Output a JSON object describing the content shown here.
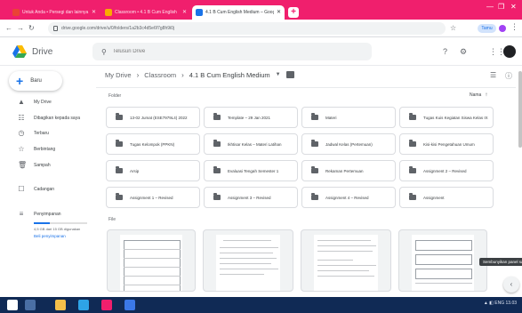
{
  "browser": {
    "tabs": [
      {
        "title": "Untuk Anda • Persegi dan lainnya",
        "favicon_color": "#ea4335",
        "active": false
      },
      {
        "title": "Classroom • 4.1 B Cum English",
        "favicon_color": "#f9ab00",
        "active": false
      },
      {
        "title": "4.1 B Cum English Medium – Google Drive",
        "favicon_color": "#1a73e8",
        "active": true
      }
    ],
    "new_tab": "+",
    "url": "drive.google.com/drive/u/0/folders/1a2b3c4d5e6f7g8h9i0j",
    "profile_label": "Tamu",
    "window_controls": [
      "—",
      "❐",
      "✕"
    ]
  },
  "drive": {
    "brand": "Drive",
    "search_placeholder": "Telusuri Drive",
    "header_icons": [
      "help-icon",
      "settings-icon",
      "apps-icon"
    ],
    "new_button": "Baru",
    "sidebar": [
      {
        "icon": "drive-icon",
        "glyph": "▲",
        "label": "My Drive"
      },
      {
        "icon": "shared-icon",
        "glyph": "☷",
        "label": "Dibagikan kepada saya"
      },
      {
        "icon": "recent-icon",
        "glyph": "◷",
        "label": "Terbaru"
      },
      {
        "icon": "star-icon",
        "glyph": "☆",
        "label": "Berbintang"
      },
      {
        "icon": "trash-icon",
        "glyph": "🗑",
        "label": "Sampah"
      },
      {
        "icon": "backup-icon",
        "glyph": "☐",
        "label": "Cadangan"
      },
      {
        "icon": "storage-icon",
        "glyph": "≡",
        "label": "Penyimpanan"
      }
    ],
    "storage": {
      "used_fraction": 0.3,
      "text": "4,5 GB dari 15 GB digunakan",
      "buy_label": "Beli penyimpanan"
    },
    "breadcrumb": [
      "My Drive",
      "Classroom",
      "4.1 B Cum English Medium"
    ],
    "view_icons": [
      "list-view-icon",
      "info-icon"
    ],
    "folders_label": "Folder",
    "sort_label": "Nama",
    "sort_arrow": "↑",
    "folders": [
      "13-02 Jumat (ESE7979L4) 2022",
      "Template – 29 Jan 2021",
      "Materi",
      "Tugas Kuis Kegiatan Siswa Kelas IX",
      "Tugas Kelompok (PPKN)",
      "Ikhtisar Kelas – Materi Latihan",
      "Jadwal Kelas (Pertemuan)",
      "Kisi-kisi Pengetahuan Umum",
      "Arsip",
      "Evaluasi Tengah Semester 1",
      "Rekaman Pertemuan",
      "Assignment 2 – Revised",
      "Assignment 1 – Revised",
      "Assignment 3 – Revised",
      "Assignment 4 – Revised",
      "Assignment"
    ],
    "files_label": "File",
    "tooltip": "Sembunyikan panel samping",
    "fab_icon": "chevron-left-icon",
    "fab_glyph": "‹"
  },
  "taskbar": {
    "apps": [
      {
        "name": "start-icon",
        "color": "#ffffff"
      },
      {
        "name": "search-taskbar-icon",
        "color": "#4a6fa5"
      },
      {
        "name": "file-explorer-icon",
        "color": "#f5c04a"
      },
      {
        "name": "edge-icon",
        "color": "#2ea3e6"
      },
      {
        "name": "chrome-icon",
        "color": "#f01f6d"
      },
      {
        "name": "photos-icon",
        "color": "#3b78e7"
      }
    ],
    "tray_text": "▲ ◧ ENG 13.03"
  }
}
